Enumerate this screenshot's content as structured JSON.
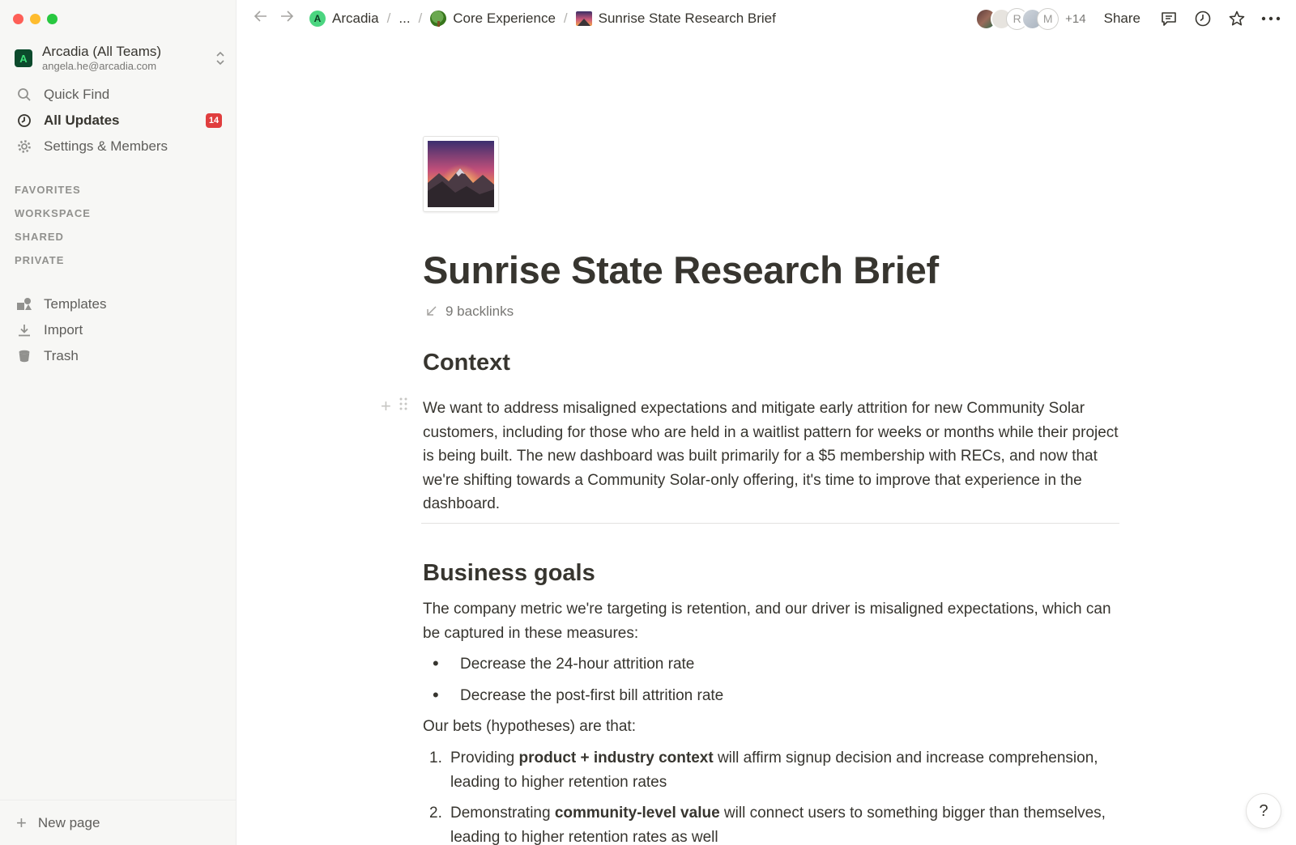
{
  "sidebar": {
    "workspace": {
      "logo_letter": "A",
      "name": "Arcadia (All Teams)",
      "email": "angela.he@arcadia.com"
    },
    "nav": [
      {
        "label": "Quick Find",
        "icon": "search-icon"
      },
      {
        "label": "All Updates",
        "icon": "clock-icon",
        "badge": "14"
      },
      {
        "label": "Settings & Members",
        "icon": "gear-icon"
      }
    ],
    "sections": [
      "FAVORITES",
      "WORKSPACE",
      "SHARED",
      "PRIVATE"
    ],
    "nav2": [
      {
        "label": "Templates",
        "icon": "templates-icon"
      },
      {
        "label": "Import",
        "icon": "download-icon"
      },
      {
        "label": "Trash",
        "icon": "trash-icon"
      }
    ],
    "new_page": "New page"
  },
  "topbar": {
    "breadcrumb": {
      "root": "Arcadia",
      "root_icon_letter": "A",
      "ellipsis": "...",
      "parent": "Core Experience",
      "current": "Sunrise State Research Brief",
      "separator": "/"
    },
    "avatars": {
      "initial_r": "R",
      "initial_m": "M",
      "more": "+14"
    },
    "share": "Share"
  },
  "page": {
    "title": "Sunrise State Research Brief",
    "backlinks": "9 backlinks",
    "context_heading": "Context",
    "context_text": "We want to address misaligned expectations and mitigate early attrition for new Community Solar customers, including for those who are held in a waitlist pattern for weeks or months while their project is being built. The new dashboard was built primarily for a $5 membership with RECs, and now that we're shifting towards a Community Solar-only offering, it's time to improve that experience in the dashboard.",
    "goals_heading": "Business goals",
    "goals_text": "The company metric we're targeting is retention, and our driver is misaligned expectations, which can be captured in these measures:",
    "bullets": [
      "Decrease the 24-hour attrition rate",
      "Decrease the post-first bill attrition rate"
    ],
    "bets_intro": "Our bets (hypotheses) are that:",
    "numbered": [
      {
        "num": "1.",
        "pre": "Providing ",
        "bold": "product + industry context",
        "post": " will affirm signup decision and increase comprehension, leading to higher retention rates"
      },
      {
        "num": "2.",
        "pre": "Demonstrating ",
        "bold": "community-level value",
        "post": " will connect users to something bigger than themselves, leading to higher retention rates as well"
      }
    ]
  },
  "help": "?"
}
